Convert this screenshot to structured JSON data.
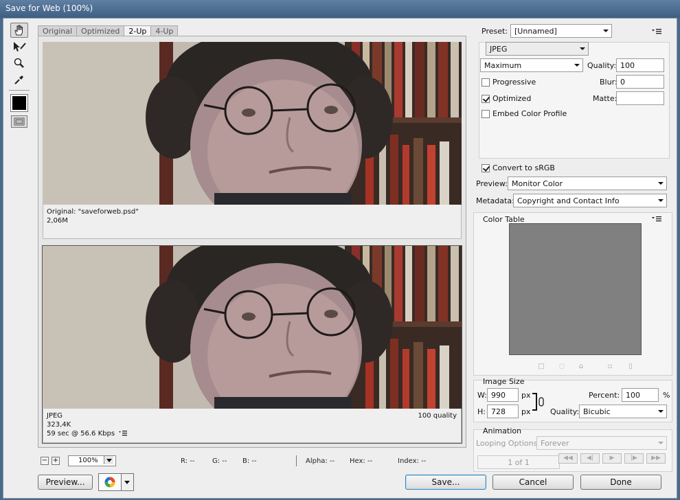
{
  "window": {
    "title": "Save for Web (100%)"
  },
  "tabs": [
    "Original",
    "Optimized",
    "2-Up",
    "4-Up"
  ],
  "active_tab": "2-Up",
  "tools": [
    "hand-tool-icon",
    "slice-select-tool-icon",
    "zoom-tool-icon",
    "eyedropper-tool-icon"
  ],
  "eyedropper_color": "#000000",
  "original_pane": {
    "name": "Original: \"saveforweb.psd\"",
    "size": "2,06M"
  },
  "optimized_pane": {
    "format": "JPEG",
    "size": "323,4K",
    "download": "59 sec @ 56.6 Kbps",
    "quality": "100 quality"
  },
  "status": {
    "zoom": "100%",
    "r": "R: --",
    "g": "G: --",
    "b": "B: --",
    "alpha": "Alpha: --",
    "hex": "Hex: --",
    "index": "Index: --"
  },
  "settings": {
    "preset_label": "Preset:",
    "preset_value": "[Unnamed]",
    "format": "JPEG",
    "quality_preset": "Maximum",
    "quality_label": "Quality:",
    "quality_value": "100",
    "progressive_label": "Progressive",
    "progressive_checked": false,
    "blur_label": "Blur:",
    "blur_value": "0",
    "optimized_label": "Optimized",
    "optimized_checked": true,
    "matte_label": "Matte:",
    "matte_value": "",
    "embed_profile_label": "Embed Color Profile",
    "embed_profile_checked": false,
    "convert_srgb_label": "Convert to sRGB",
    "convert_srgb_checked": true,
    "preview_label": "Preview:",
    "preview_value": "Monitor Color",
    "metadata_label": "Metadata:",
    "metadata_value": "Copyright and Contact Info"
  },
  "color_table": {
    "title": "Color Table",
    "swatch_color": "#808080"
  },
  "image_size": {
    "title": "Image Size",
    "w_label": "W:",
    "w_value": "990",
    "h_label": "H:",
    "h_value": "728",
    "unit": "px",
    "percent_label": "Percent:",
    "percent_value": "100",
    "percent_unit": "%",
    "quality_label": "Quality:",
    "quality_value": "Bicubic"
  },
  "animation": {
    "title": "Animation",
    "looping_label": "Looping Options:",
    "looping_value": "Forever",
    "frame_counter": "1 of 1"
  },
  "buttons": {
    "preview": "Preview...",
    "save": "Save...",
    "cancel": "Cancel",
    "done": "Done"
  }
}
